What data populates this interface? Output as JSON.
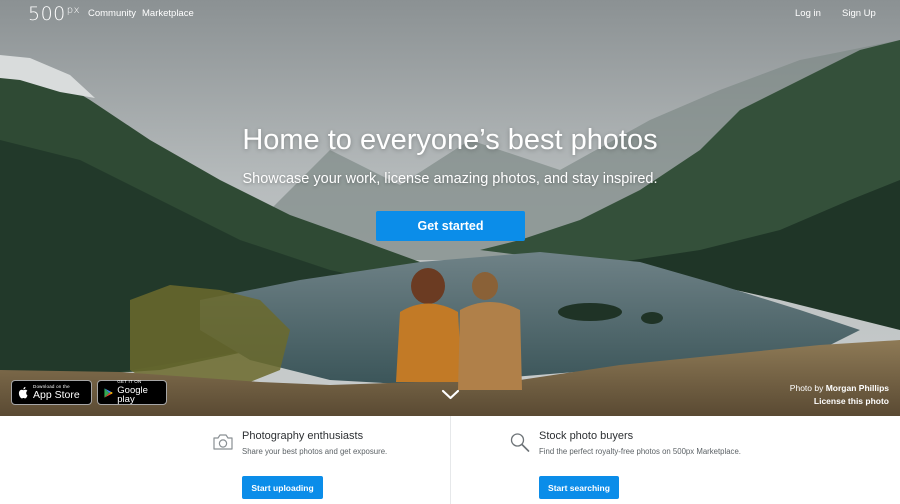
{
  "nav": {
    "logo": "500",
    "logo_suffix": "px",
    "community": "Community",
    "marketplace": "Marketplace",
    "login": "Log in",
    "signup": "Sign Up"
  },
  "hero": {
    "headline": "Home to everyone’s best photos",
    "subhead": "Showcase your work, license amazing photos, and stay inspired.",
    "cta": "Get started",
    "scroll_icon": "chevron-down-icon",
    "credit_prefix": "Photo by ",
    "credit_name": "Morgan Phillips",
    "license": "License this photo"
  },
  "badges": {
    "apple_small": "Download on the",
    "apple_big": "App Store",
    "google_small": "GET IT ON",
    "google_big": "Google play"
  },
  "features": [
    {
      "icon": "camera-icon",
      "title": "Photography enthusiasts",
      "description": "Share your best photos and get exposure.",
      "button": "Start uploading"
    },
    {
      "icon": "search-icon",
      "title": "Stock photo buyers",
      "description": "Find the perfect royalty-free photos on 500px Marketplace.",
      "button": "Start searching"
    }
  ],
  "colors": {
    "accent": "#0b8de9",
    "feature_title": "#2d3033",
    "feature_text": "#5c6266"
  }
}
